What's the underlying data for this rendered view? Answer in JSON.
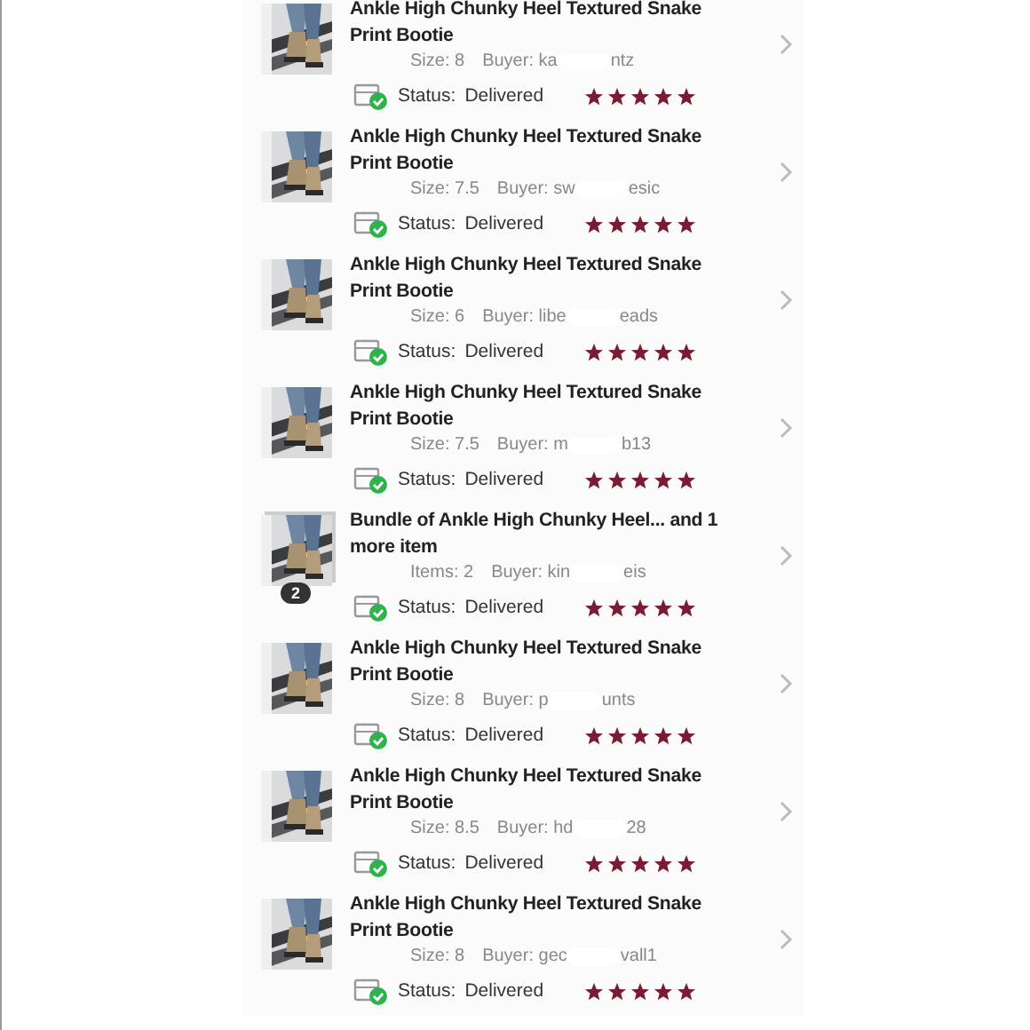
{
  "orders": [
    {
      "kind": "single",
      "title": "Ankle High Chunky Heel Textured Snake Print Bootie",
      "detail": "Size: 8",
      "buyer_start": "Buyer: ka",
      "buyer_end": "ntz",
      "status": "Status:",
      "status_value": "Delivered",
      "stars": 5
    },
    {
      "kind": "single",
      "title": "Ankle High Chunky Heel Textured Snake Print Bootie",
      "detail": "Size: 7.5",
      "buyer_start": "Buyer: sw",
      "buyer_end": "esic",
      "status": "Status:",
      "status_value": "Delivered",
      "stars": 5
    },
    {
      "kind": "single",
      "title": "Ankle High Chunky Heel Textured Snake Print Bootie",
      "detail": "Size: 6",
      "buyer_start": "Buyer: libe",
      "buyer_end": "eads",
      "status": "Status:",
      "status_value": "Delivered",
      "stars": 5
    },
    {
      "kind": "single",
      "title": "Ankle High Chunky Heel Textured Snake Print Bootie",
      "detail": "Size: 7.5",
      "buyer_start": "Buyer: m",
      "buyer_end": "b13",
      "status": "Status:",
      "status_value": "Delivered",
      "stars": 5
    },
    {
      "kind": "bundle",
      "count": "2",
      "title": "Bundle of Ankle High Chunky Heel... and 1 more item",
      "detail": "Items: 2",
      "buyer_start": "Buyer: kin",
      "buyer_end": "eis",
      "status": "Status:",
      "status_value": "Delivered",
      "stars": 5
    },
    {
      "kind": "single",
      "title": "Ankle High Chunky Heel Textured Snake Print Bootie",
      "detail": "Size: 8",
      "buyer_start": "Buyer: p",
      "buyer_end": "unts",
      "status": "Status:",
      "status_value": "Delivered",
      "stars": 5
    },
    {
      "kind": "single",
      "title": "Ankle High Chunky Heel Textured Snake Print Bootie",
      "detail": "Size: 8.5",
      "buyer_start": "Buyer: hd",
      "buyer_end": "28",
      "status": "Status:",
      "status_value": "Delivered",
      "stars": 5
    },
    {
      "kind": "single",
      "title": "Ankle High Chunky Heel Textured Snake Print Bootie",
      "detail": "Size: 8",
      "buyer_start": "Buyer: gec",
      "buyer_end": "vall1",
      "status": "Status:",
      "status_value": "Delivered",
      "stars": 5
    }
  ]
}
